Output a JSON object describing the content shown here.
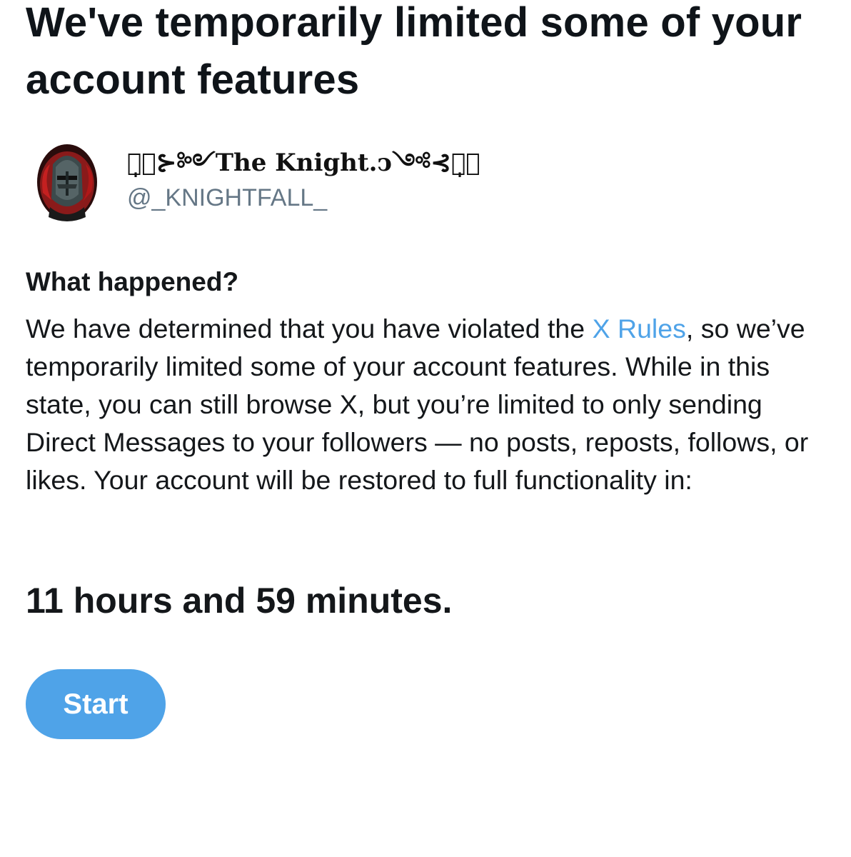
{
  "title": "We've temporarily limited some of your account features",
  "account": {
    "display_name": "‿̩͙⊱༻The Knight.ͻ༺⊰‿̩͙",
    "handle": "@_KNIGHTFALL_",
    "avatar_icon": "knight-helmet-avatar"
  },
  "section": {
    "heading": "What happened?",
    "body_before_link": "We have determined that you have violated the ",
    "rules_link_label": "X Rules",
    "body_after_link": ", so we’ve temporarily limited some of your account features. While in this state, you can still browse X, but you’re limited to only sending Direct Messages to your followers — no posts, reposts, follows, or likes. Your account will be restored to full functionality in:"
  },
  "countdown": "11 hours and 59 minutes.",
  "start_button_label": "Start",
  "colors": {
    "accent": "#4fa3e8",
    "handle": "#657786",
    "text": "#14171a"
  }
}
